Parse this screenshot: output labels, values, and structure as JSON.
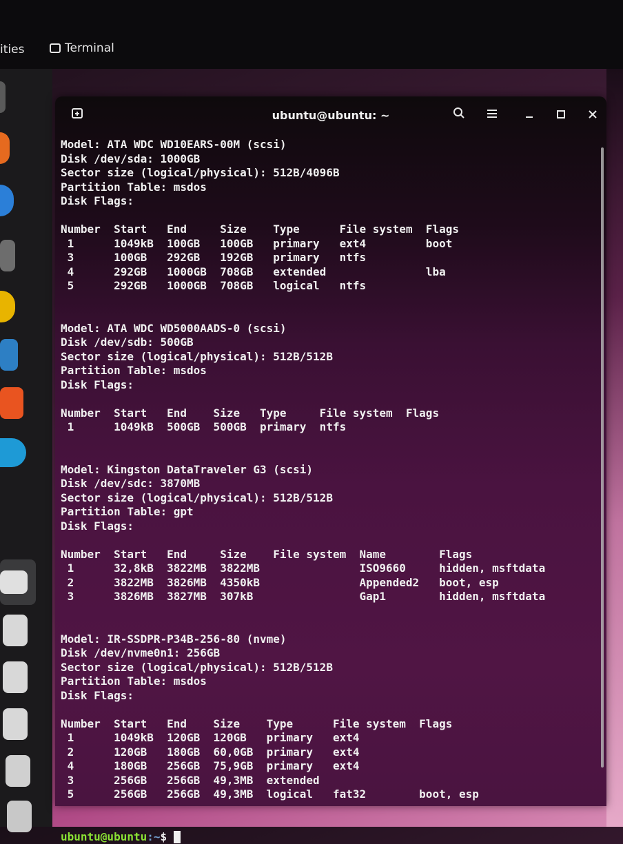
{
  "topbar": {
    "activities_label": "ities",
    "app_label": "Terminal"
  },
  "window": {
    "title": "ubuntu@ubuntu: ~",
    "icons": {
      "new_tab": "new-tab-icon",
      "search": "search-icon",
      "menu": "hamburger-menu-icon",
      "minimize": "minimize-icon",
      "maximize": "maximize-icon",
      "close": "close-icon"
    }
  },
  "terminal": {
    "lines": [
      "Model: ATA WDC WD10EARS-00M (scsi)",
      "Disk /dev/sda: 1000GB",
      "Sector size (logical/physical): 512B/4096B",
      "Partition Table: msdos",
      "Disk Flags:",
      "",
      "Number  Start   End     Size    Type      File system  Flags",
      " 1      1049kB  100GB   100GB   primary   ext4         boot",
      " 3      100GB   292GB   192GB   primary   ntfs",
      " 4      292GB   1000GB  708GB   extended               lba",
      " 5      292GB   1000GB  708GB   logical   ntfs",
      "",
      "",
      "Model: ATA WDC WD5000AADS-0 (scsi)",
      "Disk /dev/sdb: 500GB",
      "Sector size (logical/physical): 512B/512B",
      "Partition Table: msdos",
      "Disk Flags:",
      "",
      "Number  Start   End    Size   Type     File system  Flags",
      " 1      1049kB  500GB  500GB  primary  ntfs",
      "",
      "",
      "Model: Kingston DataTraveler G3 (scsi)",
      "Disk /dev/sdc: 3870MB",
      "Sector size (logical/physical): 512B/512B",
      "Partition Table: gpt",
      "Disk Flags:",
      "",
      "Number  Start   End     Size    File system  Name        Flags",
      " 1      32,8kB  3822MB  3822MB               ISO9660     hidden, msftdata",
      " 2      3822MB  3826MB  4350kB               Appended2   boot, esp",
      " 3      3826MB  3827MB  307kB                Gap1        hidden, msftdata",
      "",
      "",
      "Model: IR-SSDPR-P34B-256-80 (nvme)",
      "Disk /dev/nvme0n1: 256GB",
      "Sector size (logical/physical): 512B/512B",
      "Partition Table: msdos",
      "Disk Flags:",
      "",
      "Number  Start   End    Size    Type      File system  Flags",
      " 1      1049kB  120GB  120GB   primary   ext4",
      " 2      120GB   180GB  60,0GB  primary   ext4",
      " 4      180GB   256GB  75,9GB  primary   ext4",
      " 3      256GB   256GB  49,3MB  extended",
      " 5      256GB   256GB  49,3MB  logical   fat32        boot, esp",
      "",
      ""
    ],
    "prompt_user": "ubuntu@ubuntu",
    "prompt_path": ":~",
    "prompt_symbol": "$ "
  },
  "dock": {
    "icons": [
      "files-icon",
      "firefox-icon",
      "thunderbird-icon",
      "file-manager-icon",
      "rhythmbox-icon",
      "libreoffice-writer-icon",
      "app-center-icon",
      "help-icon",
      "terminal-icon",
      "disk-icon",
      "disk-icon",
      "disk-icon",
      "ssd-icon",
      "ssd-icon",
      "disk-icon"
    ]
  },
  "colors": {
    "prompt_user": "#8ae234",
    "prompt_path": "#729fcf",
    "terminal_text": "#f0f0f0"
  }
}
